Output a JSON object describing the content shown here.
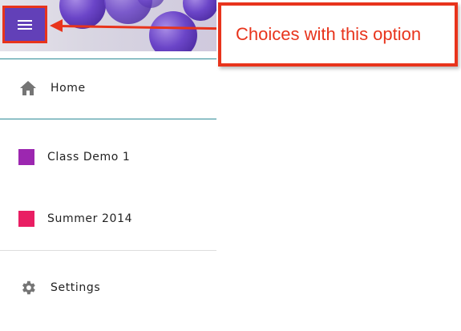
{
  "annotation": {
    "callout_text": "Choices with this option"
  },
  "header": {
    "menu_icon": "hamburger-menu-icon"
  },
  "nav": {
    "items": [
      {
        "label": "Home",
        "icon": "home-icon"
      },
      {
        "label": "Class Demo 1",
        "color": "#9c27b0"
      },
      {
        "label": "Summer 2014",
        "color": "#e91e63"
      },
      {
        "label": "Settings",
        "icon": "gear-icon"
      }
    ]
  },
  "colors": {
    "annotation_red": "#e8341c",
    "divider_teal": "#2e8b97",
    "divider_gray": "#dddddd"
  }
}
